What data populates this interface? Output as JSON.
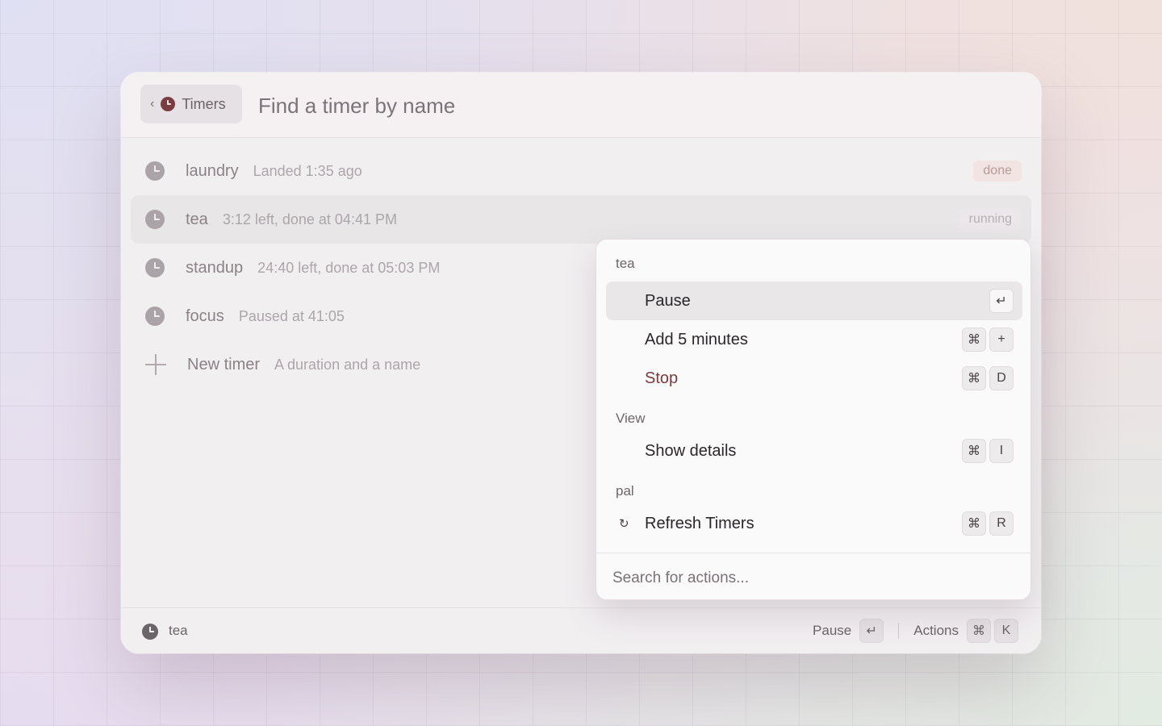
{
  "header": {
    "back_label": "Timers",
    "back_chevron": "‹",
    "search_placeholder": "Find a timer by name"
  },
  "timers": [
    {
      "name": "laundry",
      "meta": "Landed 1:35 ago",
      "status": "done"
    },
    {
      "name": "tea",
      "meta": "3:12 left, done at 04:41 PM",
      "status": "running"
    },
    {
      "name": "standup",
      "meta": "24:40 left, done at 05:03 PM",
      "status": ""
    },
    {
      "name": "focus",
      "meta": "Paused at 41:05",
      "status": ""
    }
  ],
  "new_timer": {
    "label": "New timer",
    "hint": "A duration and a name"
  },
  "footer": {
    "selected_name": "tea",
    "primary_label": "Pause",
    "primary_key": "↵",
    "actions_label": "Actions",
    "actions_keys": [
      "⌘",
      "K"
    ]
  },
  "actions_panel": {
    "sections": [
      {
        "title": "tea"
      },
      {
        "title": "View"
      },
      {
        "title": "pal"
      }
    ],
    "items": [
      {
        "label": "Pause",
        "keys": [
          "↵"
        ]
      },
      {
        "label": "Add 5 minutes",
        "keys": [
          "⌘",
          "+"
        ]
      },
      {
        "label": "Stop",
        "keys": [
          "⌘",
          "D"
        ]
      },
      {
        "label": "Show details",
        "keys": [
          "⌘",
          "I"
        ]
      },
      {
        "label": "Refresh Timers",
        "keys": [
          "⌘",
          "R"
        ],
        "icon": "↻"
      }
    ],
    "search_placeholder": "Search for actions..."
  },
  "colors": {
    "accent": "#7a3e42",
    "danger": "#7a3a3e"
  }
}
